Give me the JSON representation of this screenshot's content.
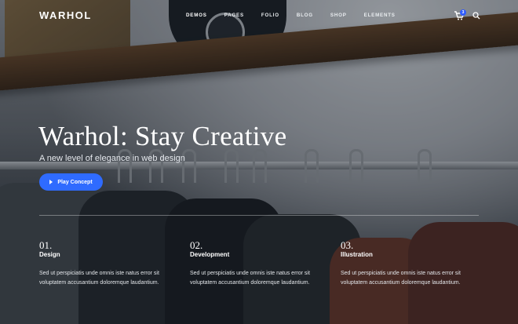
{
  "brand": {
    "logo_text": "WARHOL"
  },
  "nav": {
    "items": [
      {
        "label": "DEMOS",
        "active": true
      },
      {
        "label": "PAGES",
        "active": false
      },
      {
        "label": "FOLIO",
        "active": false
      },
      {
        "label": "BLOG",
        "active": false
      },
      {
        "label": "SHOP",
        "active": false
      },
      {
        "label": "ELEMENTS",
        "active": false
      }
    ],
    "cart_count": "3",
    "icons": [
      "cart-icon",
      "search-icon"
    ]
  },
  "hero": {
    "title": "Warhol: Stay Creative",
    "subtitle": "A new level of elegance in web design",
    "cta_label": "Play Concept",
    "cta_icon": "play-icon",
    "accent_color": "#2f6bff"
  },
  "features": [
    {
      "number": "01.",
      "title": "Design",
      "text": "Sed ut perspiciatis unde omnis iste natus error sit voluptatem accusantium doloremque laudantium."
    },
    {
      "number": "02.",
      "title": "Development",
      "text": "Sed ut perspiciatis unde omnis iste natus error sit voluptatem accusantium doloremque laudantium."
    },
    {
      "number": "03.",
      "title": "Illustration",
      "text": "Sed ut perspiciatis unde omnis iste natus error sit voluptatem accusantium doloremque laudantium."
    }
  ]
}
